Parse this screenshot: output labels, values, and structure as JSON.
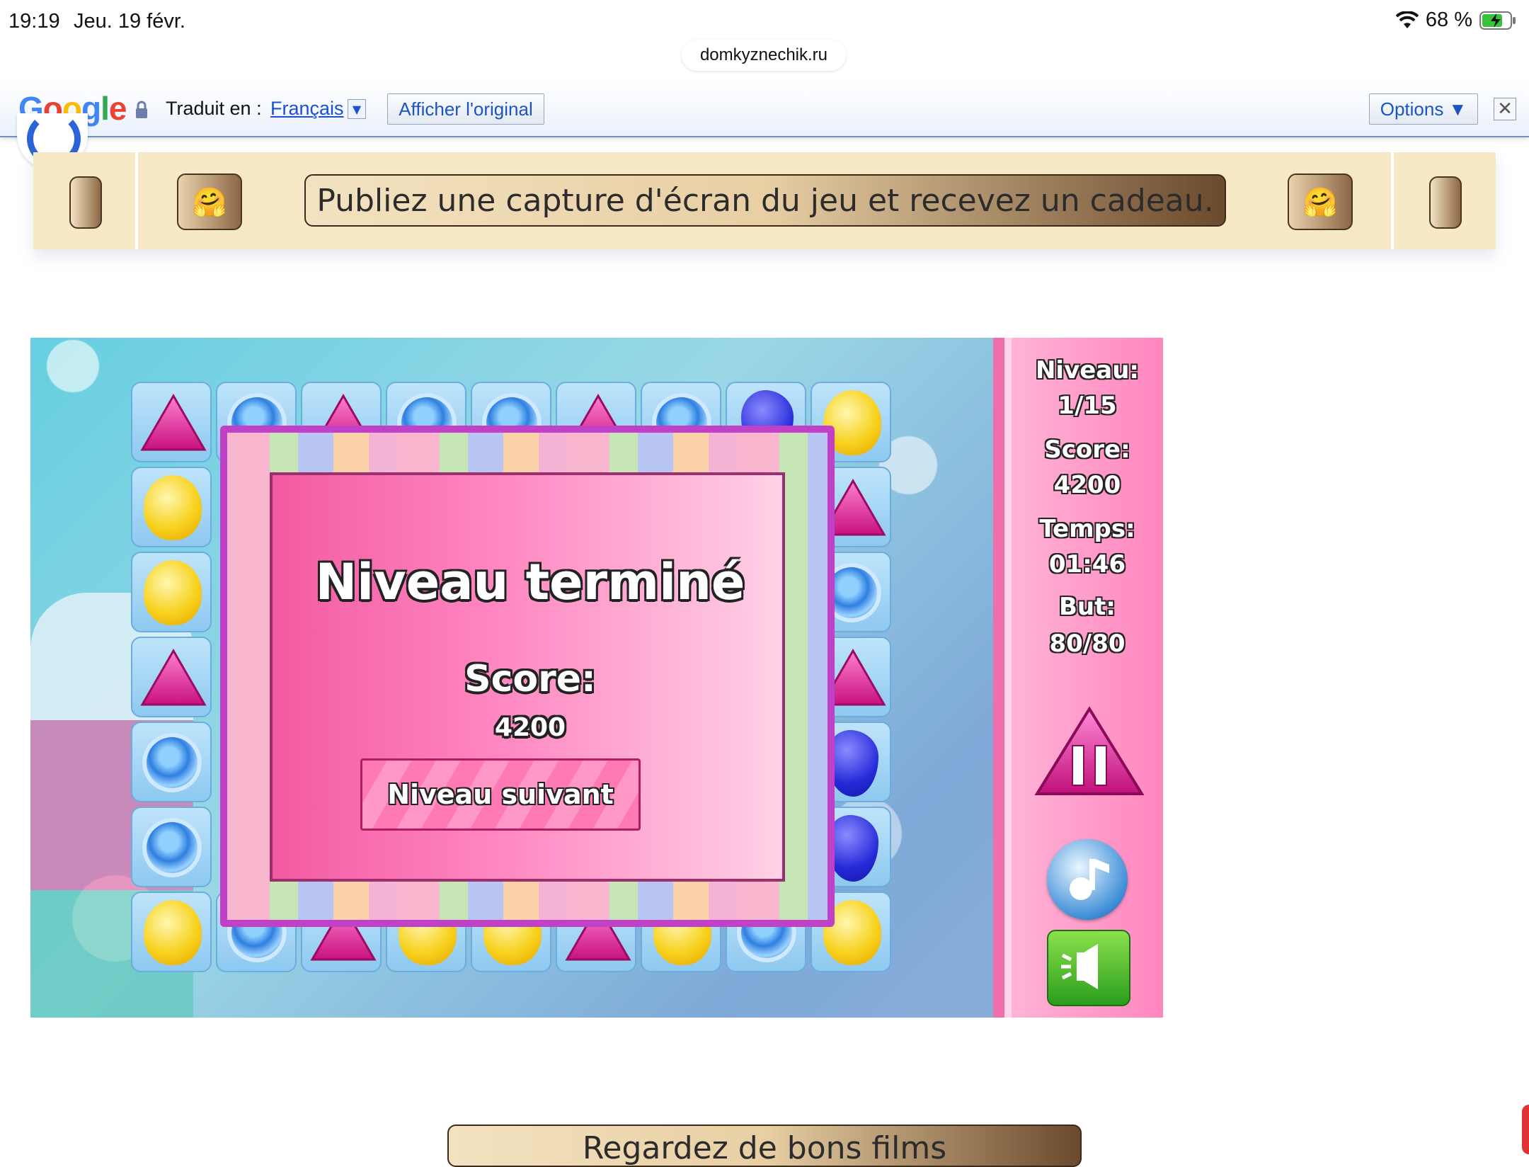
{
  "status_bar": {
    "time": "19:19",
    "date": "Jeu. 19 févr.",
    "battery": "68 %"
  },
  "browser": {
    "url": "domkyznechik.ru"
  },
  "translate_bar": {
    "logo": "Google",
    "label": "Traduit en :",
    "language": "Français",
    "show_original": "Afficher l'original",
    "options": "Options ▼",
    "close": "✕"
  },
  "banner": {
    "text": "Publiez une capture d'écran du jeu et recevez un cadeau.",
    "emoji": "🤗"
  },
  "game": {
    "sidebar": {
      "level_label": "Niveau:",
      "level_value": "1/15",
      "score_label": "Score:",
      "score_value": "4200",
      "time_label": "Temps:",
      "time_value": "01:46",
      "goal_label": "But:",
      "goal_value": "80/80"
    },
    "dialog": {
      "title": "Niveau terminé",
      "score_label": "Score:",
      "score_value": "4200",
      "next_button": "Niveau suivant"
    }
  },
  "bottom_banner": {
    "text": "Regardez de bons films"
  },
  "colors": {
    "accent_pink": "#ff79b4",
    "link_blue": "#1a4fd6"
  }
}
